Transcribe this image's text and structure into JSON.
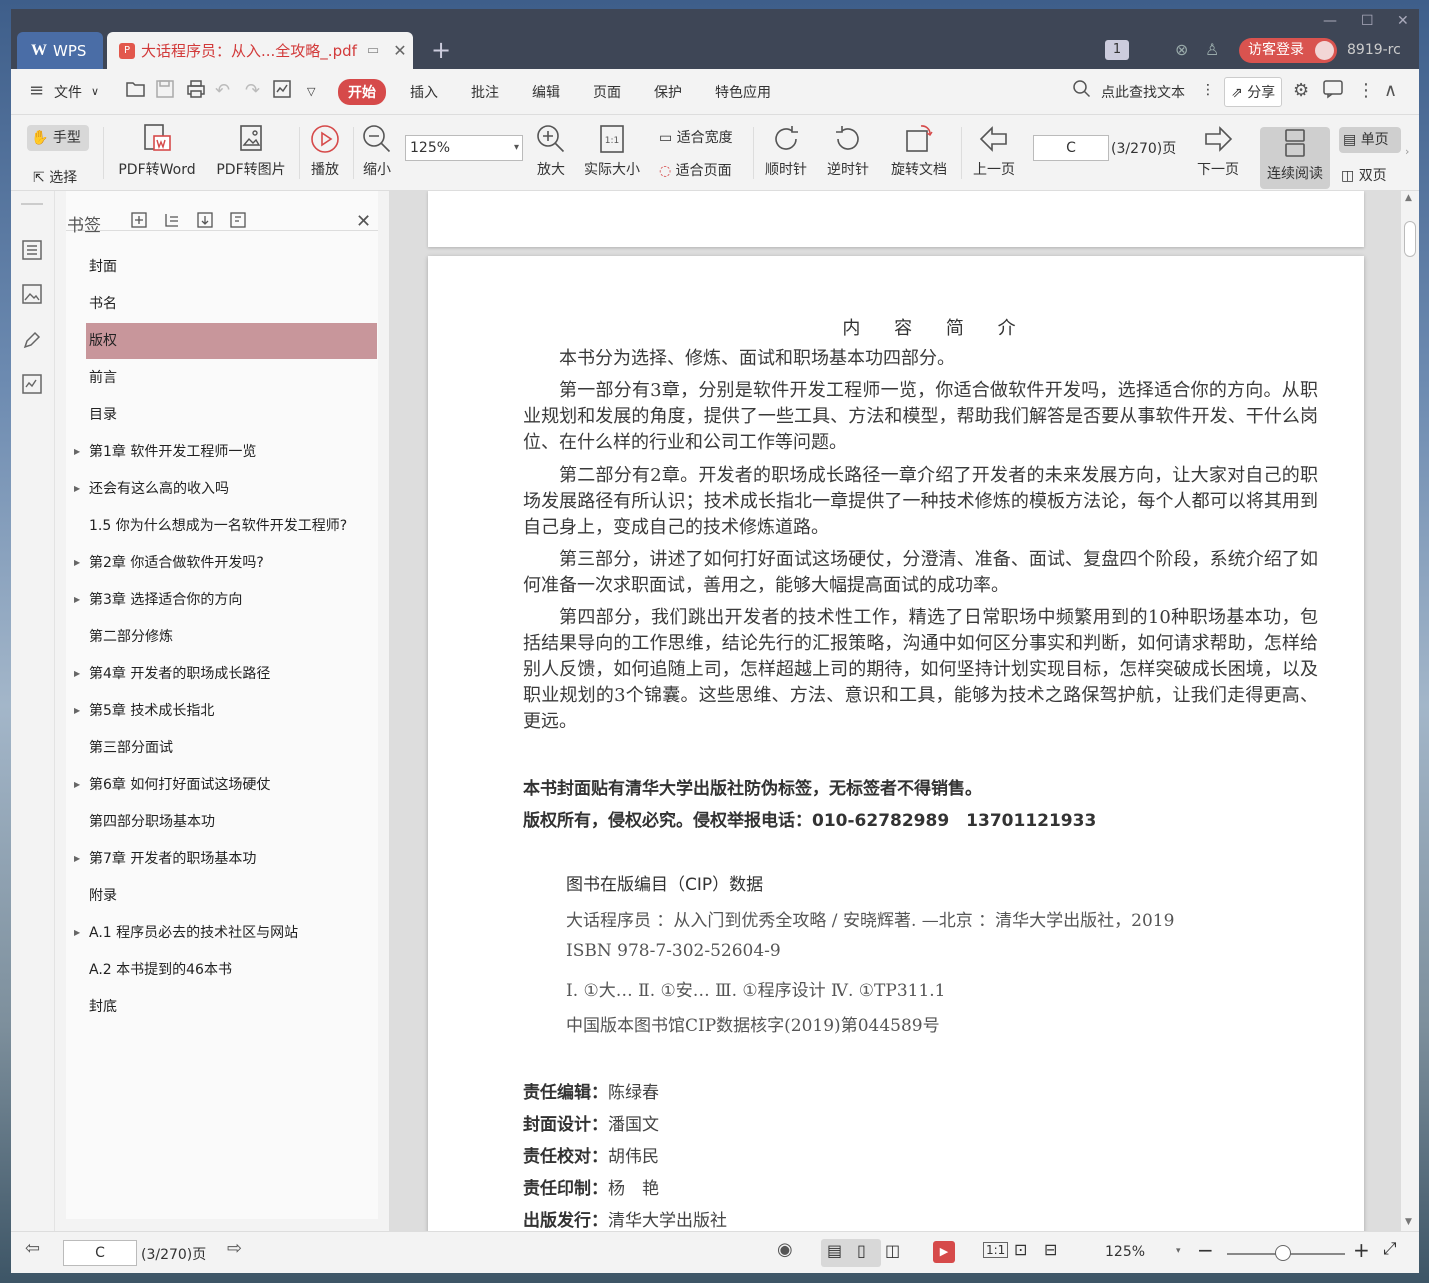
{
  "titlebar": {
    "app_tab": "WPS",
    "doc_tab": "大话程序员：从入...全攻略_.pdf",
    "badge": "1",
    "login": "访客登录",
    "user_id": "8919-rc"
  },
  "menu": {
    "file": "文件",
    "tabs": [
      "开始",
      "插入",
      "批注",
      "编辑",
      "页面",
      "保护",
      "特色应用"
    ],
    "search": "点此查找文本",
    "share": "分享"
  },
  "toolbar": {
    "hand": "手型",
    "select": "选择",
    "pdf2word": "PDF转Word",
    "pdf2img": "PDF转图片",
    "play": "播放",
    "zoom_out": "缩小",
    "zoom_value": "125%",
    "zoom_in": "放大",
    "actual": "实际大小",
    "fit_width": "适合宽度",
    "fit_page": "适合页面",
    "cw": "顺时针",
    "ccw": "逆时针",
    "rotate_doc": "旋转文档",
    "prev": "上一页",
    "page_value": "C",
    "page_count": "(3/270)页",
    "next": "下一页",
    "continuous": "连续阅读",
    "single": "单页",
    "double": "双页"
  },
  "bookmarks": {
    "title": "书签",
    "items": [
      {
        "label": "封面",
        "expandable": false
      },
      {
        "label": "书名",
        "expandable": false
      },
      {
        "label": "版权",
        "expandable": false,
        "selected": true
      },
      {
        "label": "前言",
        "expandable": false
      },
      {
        "label": "目录",
        "expandable": false
      },
      {
        "label": "第1章 软件开发工程师一览",
        "expandable": true
      },
      {
        "label": "还会有这么高的收入吗",
        "expandable": true
      },
      {
        "label": "1.5 你为什么想成为一名软件开发工程师?",
        "expandable": false
      },
      {
        "label": "第2章 你适合做软件开发吗?",
        "expandable": true
      },
      {
        "label": "第3章 选择适合你的方向",
        "expandable": true
      },
      {
        "label": "第二部分修炼",
        "expandable": false
      },
      {
        "label": "第4章 开发者的职场成长路径",
        "expandable": true
      },
      {
        "label": "第5章 技术成长指北",
        "expandable": true
      },
      {
        "label": "第三部分面试",
        "expandable": false
      },
      {
        "label": "第6章 如何打好面试这场硬仗",
        "expandable": true
      },
      {
        "label": "第四部分职场基本功",
        "expandable": false
      },
      {
        "label": "第7章 开发者的职场基本功",
        "expandable": true
      },
      {
        "label": "附录",
        "expandable": false
      },
      {
        "label": "A.1 程序员必去的技术社区与网站",
        "expandable": true
      },
      {
        "label": "A.2 本书提到的46本书",
        "expandable": false
      },
      {
        "label": "封底",
        "expandable": false
      }
    ]
  },
  "page": {
    "title": "内 容 简 介",
    "paragraphs": [
      "本书分为选择、修炼、面试和职场基本功四部分。",
      "第一部分有3章，分别是软件开发工程师一览，你适合做软件开发吗，选择适合你的方向。从职业规划和发展的角度，提供了一些工具、方法和模型，帮助我们解答是否要从事软件开发、干什么岗位、在什么样的行业和公司工作等问题。",
      "第二部分有2章。开发者的职场成长路径一章介绍了开发者的未来发展方向，让大家对自己的职场发展路径有所认识；技术成长指北一章提供了一种技术修炼的模板方法论，每个人都可以将其用到自己身上，变成自己的技术修炼道路。",
      "第三部分，讲述了如何打好面试这场硬仗，分澄清、准备、面试、复盘四个阶段，系统介绍了如何准备一次求职面试，善用之，能够大幅提高面试的成功率。",
      "第四部分，我们跳出开发者的技术性工作，精选了日常职场中频繁用到的10种职场基本功，包括结果导向的工作思维，结论先行的汇报策略，沟通中如何区分事实和判断，如何请求帮助，怎样给别人反馈，如何追随上司，怎样超越上司的期待，如何坚持计划实现目标，怎样突破成长困境，以及职业规划的3个锦囊。这些思维、方法、意识和工具，能够为技术之路保驾护航，让我们走得更高、更远。"
    ],
    "notice1": "本书封面贴有清华大学出版社防伪标签，无标签者不得销售。",
    "notice2": "版权所有，侵权必究。侵权举报电话：010-62782989　13701121933",
    "cip": [
      "图书在版编目（CIP）数据",
      "大话程序员 ：从入门到优秀全攻略 / 安晓辉著. —北京 ：清华大学出版社，2019",
      "ISBN 978-7-302-52604-9",
      "Ⅰ. ①大… Ⅱ. ①安… Ⅲ. ①程序设计 Ⅳ. ①TP311.1",
      "中国版本图书馆CIP数据核字(2019)第044589号"
    ],
    "credits": [
      {
        "k": "责任编辑：",
        "v": "陈绿春"
      },
      {
        "k": "封面设计：",
        "v": "潘国文"
      },
      {
        "k": "责任校对：",
        "v": "胡伟民"
      },
      {
        "k": "责任印制：",
        "v": "杨　艳"
      },
      {
        "k": "出版发行：",
        "v": "清华大学出版社"
      }
    ]
  },
  "status": {
    "page_value": "C",
    "page_count": "(3/270)页",
    "zoom": "125%"
  },
  "colors": {
    "accent": "#d64a4a",
    "titlebar": "#3e4656",
    "selected_bookmark": "#c8969b"
  }
}
